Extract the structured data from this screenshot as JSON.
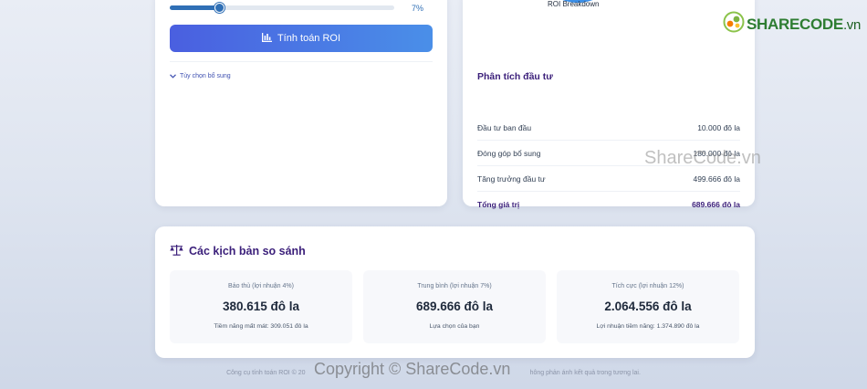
{
  "calculator": {
    "slider_value_label": "7%",
    "slider_fraction": 0.22,
    "calculate_button_label": "Tính toán ROI",
    "extra_options_label": "Tùy chọn bổ sung"
  },
  "breakdown": {
    "chart_title": "ROI Breakdown",
    "section_heading": "Phân tích đầu tư",
    "rows": [
      {
        "label": "Đầu tư ban đầu",
        "value": "10.000 đô la"
      },
      {
        "label": "Đóng góp bổ sung",
        "value": "180.000 đô la"
      },
      {
        "label": "Tăng trưởng đầu tư",
        "value": "499.666 đô la"
      },
      {
        "label": "Tổng giá trị",
        "value": "689.666 đô la"
      }
    ],
    "colors": {
      "principal": "#5ec8f0",
      "contributions": "#3b8fe8",
      "growth": "#1d4ed8"
    }
  },
  "scenarios": {
    "heading": "Các kịch bản so sánh",
    "items": [
      {
        "label": "Bảo thủ (lợi nhuận 4%)",
        "value": "380.615 đô la",
        "note": "Tiềm năng mất mát: 309.051 đô la"
      },
      {
        "label": "Trung bình (lợi nhuận 7%)",
        "value": "689.666 đô la",
        "note": "Lựa chọn của bạn"
      },
      {
        "label": "Tích cực (lợi nhuận 12%)",
        "value": "2.064.556 đô la",
        "note": "Lợi nhuận tiềm năng: 1.374.890 đô la"
      }
    ]
  },
  "footer": {
    "left_text": "Công cụ tính toán ROI © 20",
    "right_text": "hông phản ánh kết quả trong tương lai."
  },
  "watermarks": {
    "logo_text": "SHARECODE",
    "logo_suffix": ".vn",
    "mid": "ShareCode.vn",
    "bottom": "Copyright © ShareCode.vn"
  },
  "icons": {
    "calculate": "bar-chart-icon",
    "extra": "chevron-down-icon",
    "scenarios": "balance-scale-icon"
  }
}
